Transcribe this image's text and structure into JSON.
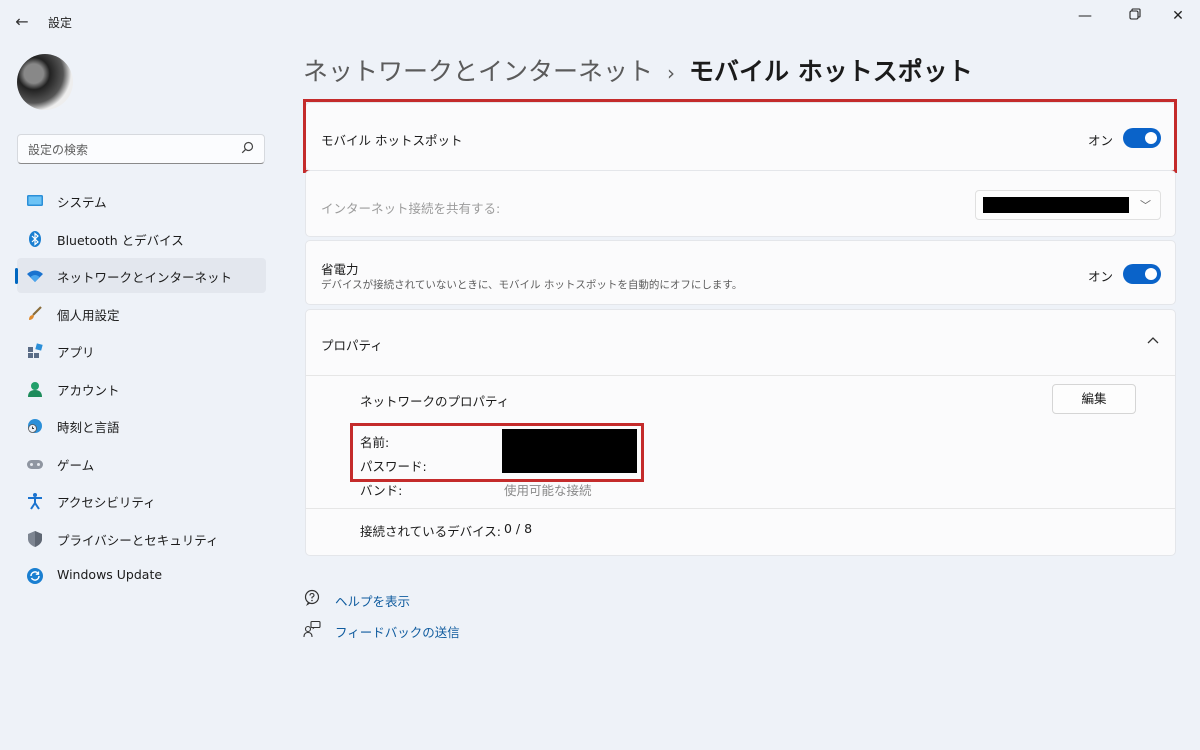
{
  "window": {
    "title": "設定",
    "back_icon": "back-arrow-icon",
    "controls": [
      "minimize-icon",
      "restore-icon",
      "close-icon"
    ]
  },
  "sidebar": {
    "search": {
      "placeholder": "設定の検索",
      "icon": "search-icon"
    },
    "items": [
      {
        "label": "システム",
        "icon": "system-icon",
        "active": false
      },
      {
        "label": "Bluetooth とデバイス",
        "icon": "bluetooth-icon",
        "active": false
      },
      {
        "label": "ネットワークとインターネット",
        "icon": "wifi-icon",
        "active": true
      },
      {
        "label": "個人用設定",
        "icon": "brush-icon",
        "active": false
      },
      {
        "label": "アプリ",
        "icon": "apps-icon",
        "active": false
      },
      {
        "label": "アカウント",
        "icon": "account-icon",
        "active": false
      },
      {
        "label": "時刻と言語",
        "icon": "globe-clock-icon",
        "active": false
      },
      {
        "label": "ゲーム",
        "icon": "gamepad-icon",
        "active": false
      },
      {
        "label": "アクセシビリティ",
        "icon": "accessibility-icon",
        "active": false
      },
      {
        "label": "プライバシーとセキュリティ",
        "icon": "shield-icon",
        "active": false
      },
      {
        "label": "Windows Update",
        "icon": "update-icon",
        "active": false
      }
    ]
  },
  "breadcrumb": {
    "parent": "ネットワークとインターネット",
    "separator": "›",
    "current": "モバイル ホットスポット"
  },
  "hotspot": {
    "label": "モバイル ホットスポット",
    "state": "オン",
    "enabled": true
  },
  "share": {
    "label": "インターネット接続を共有する:",
    "value_redacted": true
  },
  "power_saving": {
    "label": "省電力",
    "description": "デバイスが接続されていないときに、モバイル ホットスポットを自動的にオフにします。",
    "state": "オン",
    "enabled": true
  },
  "properties": {
    "header": "プロパティ",
    "network_properties_label": "ネットワークのプロパティ",
    "edit_label": "編集",
    "name_label": "名前:",
    "password_label": "パスワード:",
    "band_label": "バンド:",
    "band_value": "使用可能な接続",
    "devices_label": "接続されているデバイス:",
    "devices_value": "0 / 8"
  },
  "links": {
    "help": "ヘルプを表示",
    "feedback": "フィードバックの送信"
  },
  "colors": {
    "accent": "#0a63c9",
    "highlight_box": "#c42b2b",
    "background": "#eef2f8",
    "link": "#0f5b9e"
  }
}
